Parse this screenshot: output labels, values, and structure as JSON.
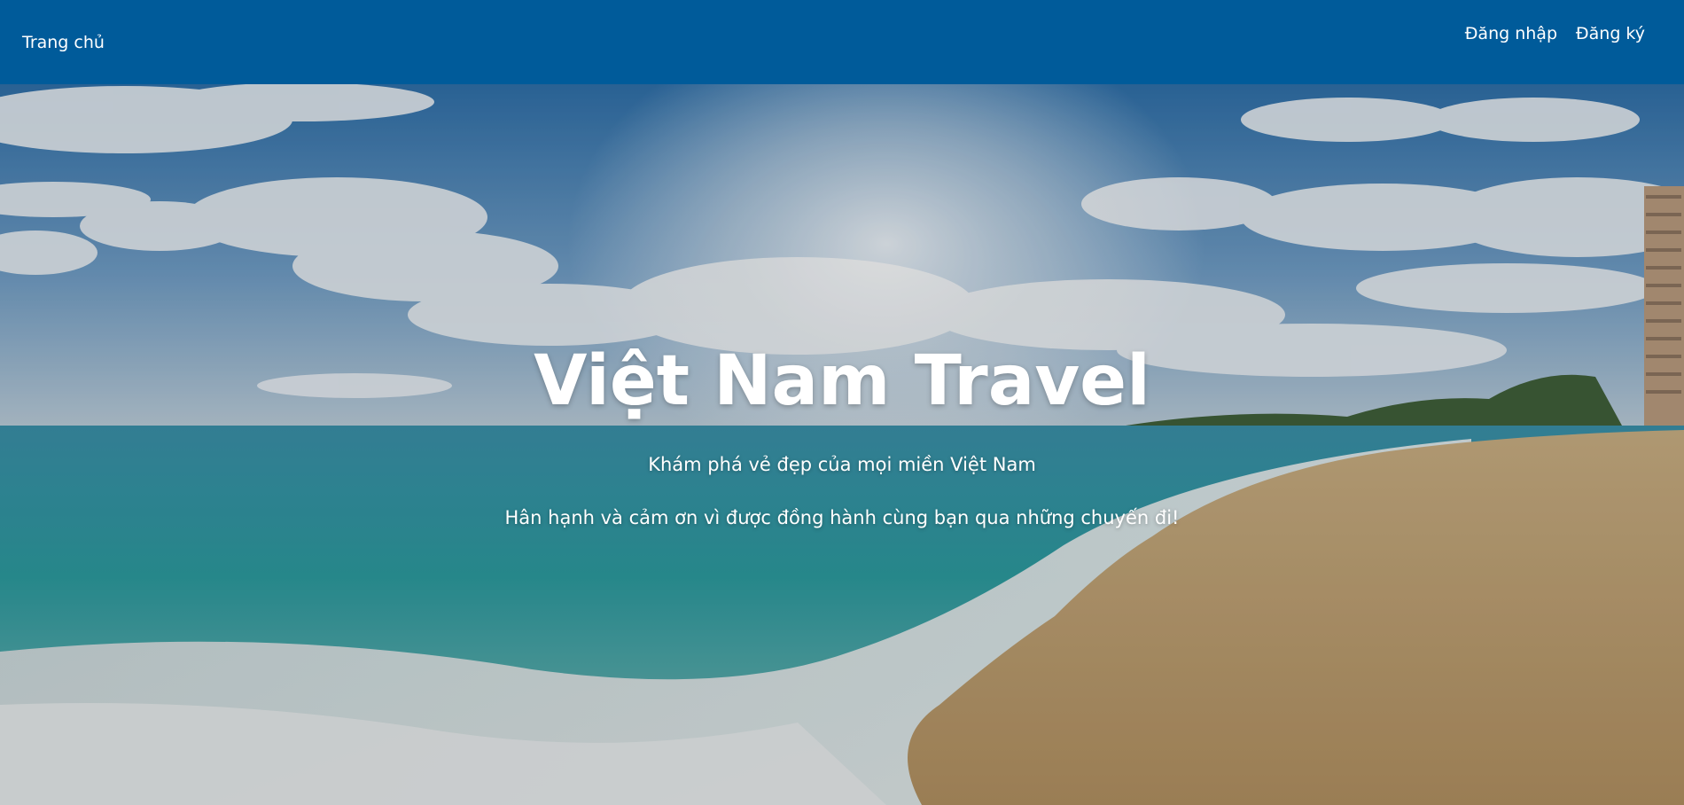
{
  "navbar": {
    "home_label": "Trang chủ",
    "login_label": "Đăng nhập",
    "register_label": "Đăng ký",
    "background_color": "#005b9a"
  },
  "hero": {
    "title": "Việt Nam Travel",
    "subtitle": "Khám phá vẻ đẹp của mọi miền Việt Nam",
    "thanks": "Hân hạnh và cảm ơn vì được đồng hành cùng bạn qua những chuyến đi!",
    "background_image": "beach-photo"
  }
}
